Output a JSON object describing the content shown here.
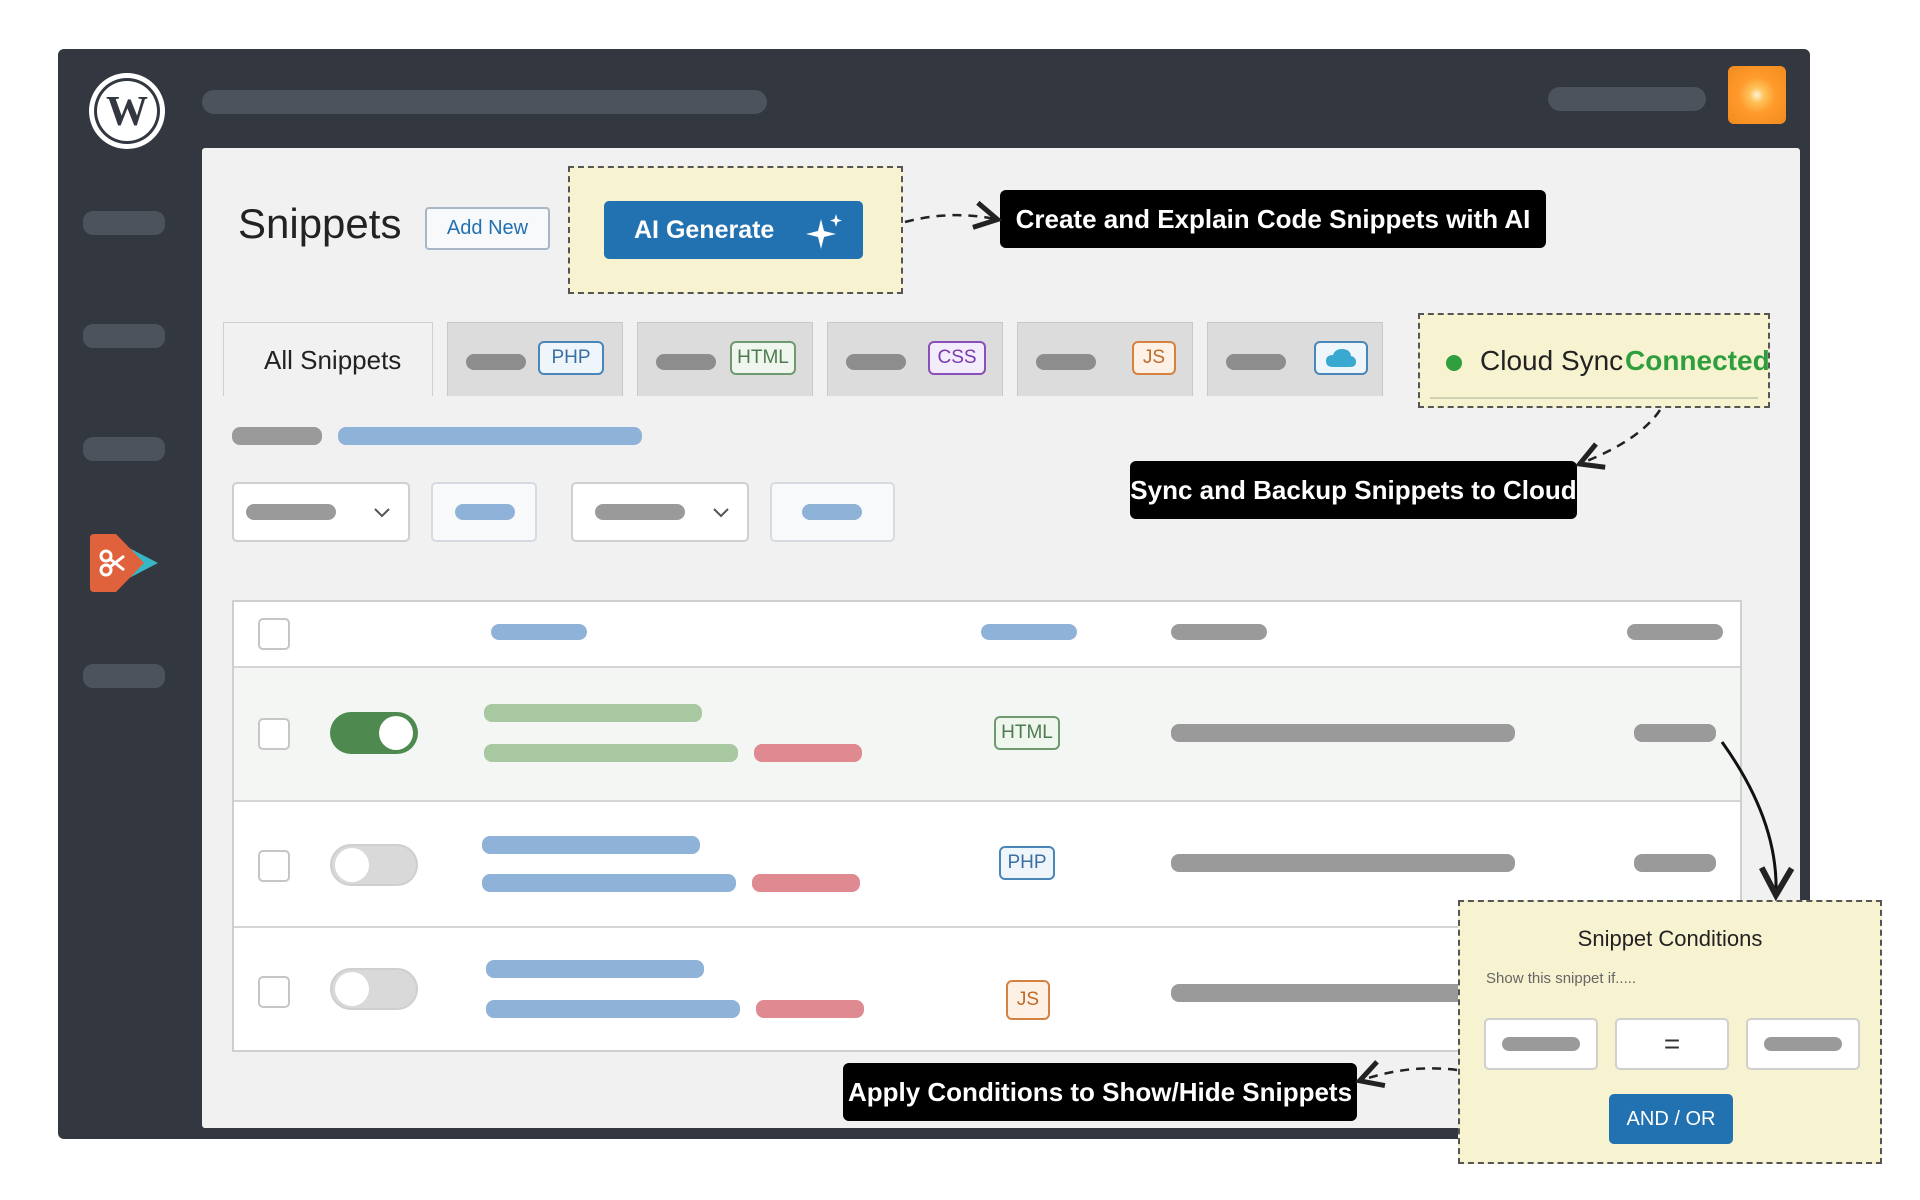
{
  "app": {
    "logo": "wordpress-logo",
    "plugin_logo": "scissors-play-logo"
  },
  "colors": {
    "accent": "#2271b1",
    "frame": "#323740",
    "highlight": "#f7f2d0",
    "success": "#2e9e3e"
  },
  "header": {
    "title": "Snippets",
    "add_new_label": "Add New",
    "ai_generate_label": "AI Generate",
    "ai_icon": "sparkle-icon"
  },
  "callouts": {
    "ai": "Create and Explain Code Snippets with AI",
    "cloud": "Sync and Backup Snippets to Cloud",
    "conditions": "Apply Conditions to Show/Hide Snippets"
  },
  "tabs": {
    "all_label": "All Snippets",
    "php": "PHP",
    "html": "HTML",
    "css": "CSS",
    "js": "JS",
    "cloud_icon": "cloud-icon"
  },
  "cloud_sync": {
    "label": "Cloud Sync",
    "status": "Connected"
  },
  "table": {
    "rows": [
      {
        "active": true,
        "type": "HTML"
      },
      {
        "active": false,
        "type": "PHP"
      },
      {
        "active": false,
        "type": "JS"
      }
    ]
  },
  "conditions": {
    "title": "Snippet Conditions",
    "subtitle": "Show this snippet if.....",
    "operator": "=",
    "and_or_label": "AND / OR"
  }
}
